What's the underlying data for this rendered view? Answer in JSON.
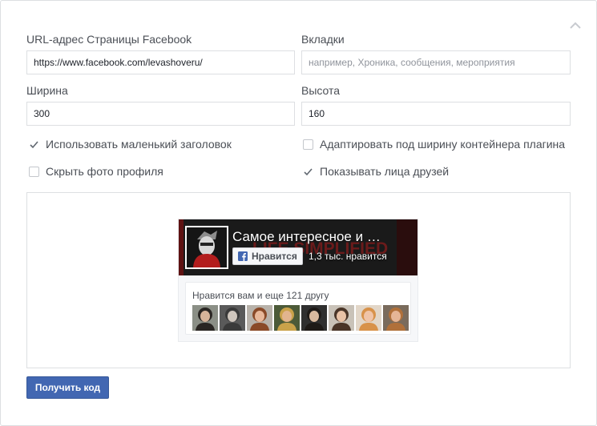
{
  "form": {
    "url_label": "URL-адрес Страницы Facebook",
    "url_value": "https://www.facebook.com/levashoveru/",
    "tabs_label": "Вкладки",
    "tabs_placeholder": "например, Хроника, сообщения, мероприятия",
    "width_label": "Ширина",
    "width_value": "300",
    "height_label": "Высота",
    "height_value": "160"
  },
  "options": [
    {
      "label": "Использовать маленький заголовок",
      "checked": true
    },
    {
      "label": "Адаптировать под ширину контейнера плагина",
      "checked": false
    },
    {
      "label": "Скрыть фото профиля",
      "checked": false
    },
    {
      "label": "Показывать лица друзей",
      "checked": true
    }
  ],
  "plugin": {
    "page_name": "Самое интересное и …",
    "cover_text": "LIFE SIMPLIFIED",
    "like_button": "Нравится",
    "like_count": "1,3 тыс. нравится",
    "friends_text": "Нравится вам и еще 121 другу",
    "friend_faces": [
      {
        "bg": "#8b8f86",
        "skin": "#d7b49a",
        "hair": "#2a2623"
      },
      {
        "bg": "#5a5a5a",
        "skin": "#cfc6bd",
        "hair": "#3a3a3a"
      },
      {
        "bg": "#b8b2aa",
        "skin": "#e8b89a",
        "hair": "#8a4a28"
      },
      {
        "bg": "#4c5a38",
        "skin": "#e2b48e",
        "hair": "#caa24a"
      },
      {
        "bg": "#2f2f2f",
        "skin": "#d9b99e",
        "hair": "#1e1a17"
      },
      {
        "bg": "#c9c2b8",
        "skin": "#e9c2a6",
        "hair": "#4a3528"
      },
      {
        "bg": "#e2d6c8",
        "skin": "#f0c4a8",
        "hair": "#d8924a"
      },
      {
        "bg": "#7a6b5c",
        "skin": "#e5b596",
        "hair": "#b0703a"
      }
    ]
  },
  "get_code_button": "Получить код",
  "colors": {
    "accent": "#4267b2",
    "border": "#dddfe2",
    "text": "#4b4f56",
    "cover_text": "#7a1c1c"
  },
  "icons": {
    "collapse": "chevron-up-icon",
    "checked": "checkmark-icon",
    "like": "facebook-f-icon"
  }
}
